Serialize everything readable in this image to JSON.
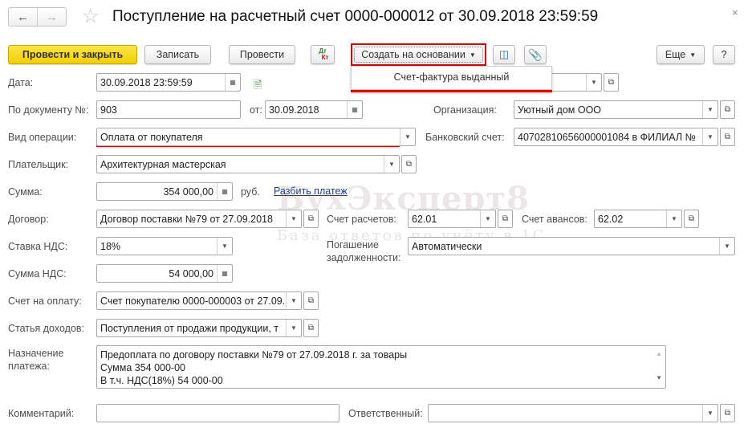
{
  "title": "Поступление на расчетный счет 0000-000012 от 30.09.2018 23:59:59",
  "watermark": {
    "line1": "БухЭксперт8",
    "line2": "База ответов по учёту в 1С"
  },
  "toolbar": {
    "post_close": "Провести и закрыть",
    "save": "Записать",
    "post": "Провести",
    "dtkt_top": "Дт",
    "dtkt_bottom": "Кт",
    "create_based": "Создать на основании",
    "more": "Еще",
    "help": "?"
  },
  "popup": {
    "items": [
      "Счет-фактура выданный"
    ]
  },
  "labels": {
    "date": "Дата:",
    "doc_no": "По документу №:",
    "from": "от:",
    "org": "Организация:",
    "op_type": "Вид операции:",
    "bank_acc": "Банковский счет:",
    "payer": "Плательщик:",
    "sum": "Сумма:",
    "currency": "руб.",
    "contract": "Договор:",
    "settle_acc": "Счет расчетов:",
    "advance_acc": "Счет авансов:",
    "vat_rate": "Ставка НДС:",
    "repayment_1": "Погашение",
    "repayment_2": "задолженности:",
    "vat_sum": "Сумма НДС:",
    "invoice": "Счет на оплату:",
    "income_item": "Статья доходов:",
    "purpose_1": "Назначение",
    "purpose_2": "платежа:",
    "comment": "Комментарий:",
    "responsible": "Ответственный:"
  },
  "split_link": "Разбить платеж",
  "fields": {
    "date": "30.09.2018 23:59:59",
    "hidden": "",
    "doc_no": "903",
    "doc_date": "30.09.2018",
    "org": "Уютный дом ООО",
    "op_type": "Оплата от покупателя",
    "bank_acc": "40702810656000001084 в ФИЛИАЛ №",
    "payer": "Архитектурная мастерская",
    "sum": "354 000,00",
    "contract": "Договор поставки №79 от 27.09.2018",
    "settle_acc": "62.01",
    "advance_acc": "62.02",
    "vat_rate": "18%",
    "repayment": "Автоматически",
    "vat_sum": "54 000,00",
    "invoice": "Счет покупателю 0000-000003 от 27.09.",
    "income_item": "Поступления от продажи продукции, т",
    "comment": "",
    "responsible": ""
  },
  "purpose_lines": [
    "Предоплата по договору поставки №79 от 27.09.2018 г. за товары",
    "Сумма 354 000-00",
    "В т.ч. НДС(18%) 54 000-00"
  ],
  "colors": {
    "accent_yellow": "#f5d800",
    "highlight_red": "#e60000",
    "link": "#1a3e9e"
  }
}
